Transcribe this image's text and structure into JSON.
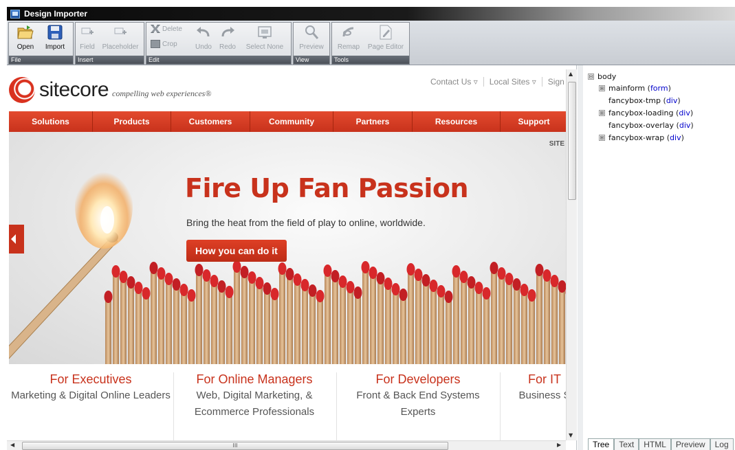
{
  "window": {
    "title": "Design Importer"
  },
  "ribbon": {
    "groups": [
      {
        "label": "File",
        "tools": [
          "Open",
          "Import"
        ]
      },
      {
        "label": "Insert",
        "tools": [
          "Field",
          "Placeholder"
        ]
      },
      {
        "label": "Edit",
        "small_tools": [
          "Delete",
          "Crop"
        ],
        "tools": [
          "Undo",
          "Redo",
          "Select None"
        ]
      },
      {
        "label": "View",
        "tools": [
          "Preview"
        ]
      },
      {
        "label": "Tools",
        "tools": [
          "Remap",
          "Page Editor"
        ]
      }
    ]
  },
  "site": {
    "logo_text": "sitecore",
    "logo_tagline": "compelling web experiences®",
    "utility_nav": [
      "Contact Us ▿",
      "Local Sites ▿",
      "Sign"
    ],
    "main_nav": [
      "Solutions",
      "Products",
      "Customers",
      "Community",
      "Partners",
      "Resources",
      "Support"
    ],
    "hero": {
      "site_label": "SITE",
      "title": "Fire Up Fan Passion",
      "subtitle": "Bring the heat from the field of play to online, worldwide.",
      "button": "How you can do it"
    },
    "audiences": [
      {
        "heading": "For Executives",
        "desc": [
          "Marketing & Digital Online Leaders"
        ]
      },
      {
        "heading": "For Online Managers",
        "desc": [
          "Web, Digital Marketing, &",
          "Ecommerce Professionals"
        ]
      },
      {
        "heading": "For Developers",
        "desc": [
          "Front & Back End Systems",
          "Experts"
        ]
      },
      {
        "heading": "For IT",
        "desc": [
          "Business S"
        ]
      }
    ]
  },
  "scroll": {
    "hscroll_grip": "III"
  },
  "tree": {
    "nodes": [
      {
        "name": "body",
        "tag": "",
        "expander": "⊟",
        "level": 0
      },
      {
        "name": "mainform",
        "tag": "form",
        "expander": "⊞",
        "level": 1
      },
      {
        "name": "fancybox-tmp",
        "tag": "div",
        "expander": "",
        "level": 1
      },
      {
        "name": "fancybox-loading",
        "tag": "div",
        "expander": "⊞",
        "level": 1
      },
      {
        "name": "fancybox-overlay",
        "tag": "div",
        "expander": "",
        "level": 1
      },
      {
        "name": "fancybox-wrap",
        "tag": "div",
        "expander": "⊞",
        "level": 1
      }
    ]
  },
  "bottom_tabs": [
    "Tree",
    "Text",
    "HTML",
    "Preview",
    "Log"
  ],
  "colors": {
    "brand_red": "#c8321c",
    "tree_tag": "#0000cc"
  }
}
